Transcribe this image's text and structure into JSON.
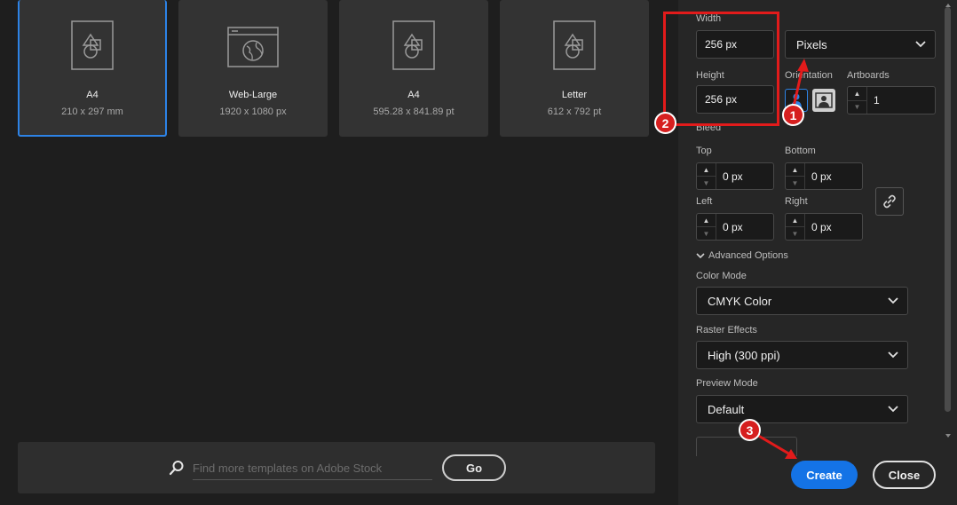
{
  "templates": [
    {
      "name": "A4",
      "size": "210 x 297 mm",
      "icon": "document-shapes-icon",
      "selected": true
    },
    {
      "name": "Web-Large",
      "size": "1920 x 1080 px",
      "icon": "web-page-icon",
      "selected": false
    },
    {
      "name": "A4",
      "size": "595.28 x 841.89 pt",
      "icon": "document-shapes-icon",
      "selected": false
    },
    {
      "name": "Letter",
      "size": "612 x 792 pt",
      "icon": "document-shapes-icon",
      "selected": false
    }
  ],
  "search": {
    "placeholder": "Find more templates on Adobe Stock",
    "go_label": "Go"
  },
  "details": {
    "width_label": "Width",
    "width_value": "256 px",
    "units_value": "Pixels",
    "height_label": "Height",
    "height_value": "256 px",
    "orientation_label": "Orientation",
    "artboards_label": "Artboards",
    "artboards_value": "1",
    "bleed_label": "Bleed",
    "top_label": "Top",
    "top_value": "0 px",
    "bottom_label": "Bottom",
    "bottom_value": "0 px",
    "left_label": "Left",
    "left_value": "0 px",
    "right_label": "Right",
    "right_value": "0 px",
    "advanced_label": "Advanced Options",
    "color_mode_label": "Color Mode",
    "color_mode_value": "CMYK Color",
    "raster_label": "Raster Effects",
    "raster_value": "High (300 ppi)",
    "preview_label": "Preview Mode",
    "preview_value": "Default"
  },
  "buttons": {
    "create": "Create",
    "close": "Close"
  },
  "annotations": {
    "badge1": "1",
    "badge2": "2",
    "badge3": "3"
  },
  "colors": {
    "accent": "#1473e6",
    "selection": "#2d83e6",
    "annotation": "#e21b1b"
  }
}
